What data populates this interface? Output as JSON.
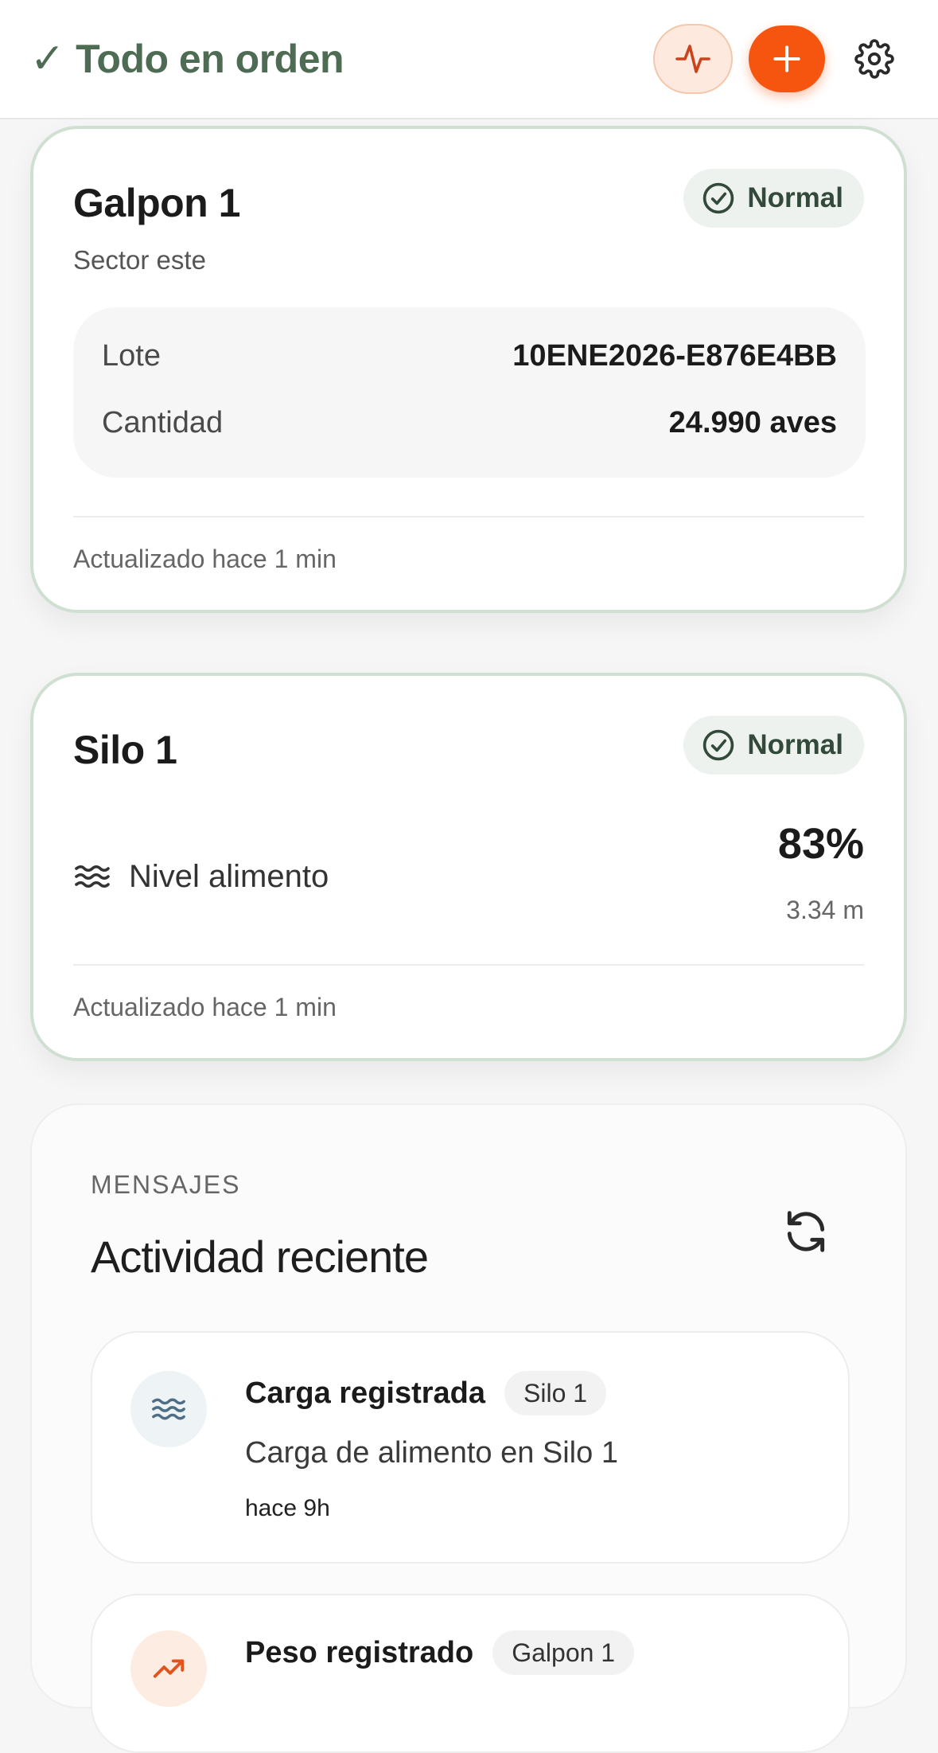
{
  "header": {
    "status_check": "✓",
    "status_text": "Todo en orden"
  },
  "galpon": {
    "title": "Galpon 1",
    "badge": "Normal",
    "subtitle": "Sector este",
    "lote_label": "Lote",
    "lote_value": "10ENE2026-E876E4BB",
    "cantidad_label": "Cantidad",
    "cantidad_value": "24.990 aves",
    "updated": "Actualizado hace 1 min"
  },
  "silo": {
    "title": "Silo 1",
    "badge": "Normal",
    "level_label": "Nivel alimento",
    "level_value": "83%",
    "level_height": "3.34 m",
    "updated": "Actualizado hace 1 min"
  },
  "messages": {
    "eyebrow": "MENSAJES",
    "heading": "Actividad reciente",
    "items": [
      {
        "title": "Carga registrada",
        "tag": "Silo 1",
        "description": "Carga de alimento en Silo 1",
        "time": "hace 9h",
        "icon": "waves-icon"
      },
      {
        "title": "Peso registrado",
        "tag": "Galpon 1",
        "icon": "trend-up-icon"
      }
    ]
  },
  "colors": {
    "accent_orange": "#f6550f",
    "status_green": "#4e6c54",
    "card_border": "#cfe0d2"
  }
}
